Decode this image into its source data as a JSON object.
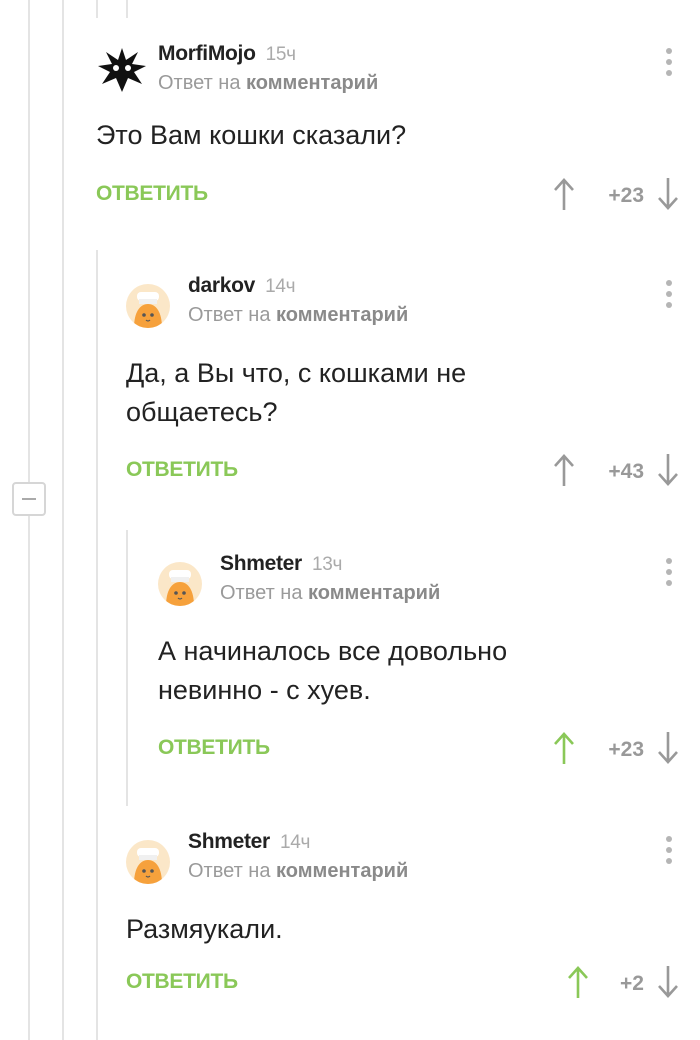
{
  "comments": [
    {
      "author": "MorfiMojo",
      "time": "15ч",
      "reply_prefix": "Ответ на",
      "reply_target": "комментарий",
      "text": "Это Вам кошки сказали?",
      "reply_label": "ОТВЕТИТЬ",
      "score": "+23",
      "upvoted": false
    },
    {
      "author": "darkov",
      "time": "14ч",
      "reply_prefix": "Ответ на",
      "reply_target": "комментарий",
      "text": "Да, а Вы что, с кошками не общаетесь?",
      "reply_label": "ОТВЕТИТЬ",
      "score": "+43",
      "upvoted": false
    },
    {
      "author": "Shmeter",
      "time": "13ч",
      "reply_prefix": "Ответ на",
      "reply_target": "комментарий",
      "text": "А начиналось все довольно невинно - с хуев.",
      "reply_label": "ОТВЕТИТЬ",
      "score": "+23",
      "upvoted": true
    },
    {
      "author": "Shmeter",
      "time": "14ч",
      "reply_prefix": "Ответ на",
      "reply_target": "комментарий",
      "text": "Размяукали.",
      "reply_label": "ОТВЕТИТЬ",
      "score": "+2",
      "upvoted": true
    }
  ],
  "colors": {
    "accent_green": "#8ac858",
    "vote_gray": "#999999",
    "thread_line": "#e4e4e4"
  },
  "icons": {
    "upvote": "arrow-up-icon",
    "downvote": "arrow-down-icon",
    "menu": "more-vertical-icon",
    "collapse": "minus-square-icon",
    "avatar_default": "cat-chef-avatar"
  }
}
